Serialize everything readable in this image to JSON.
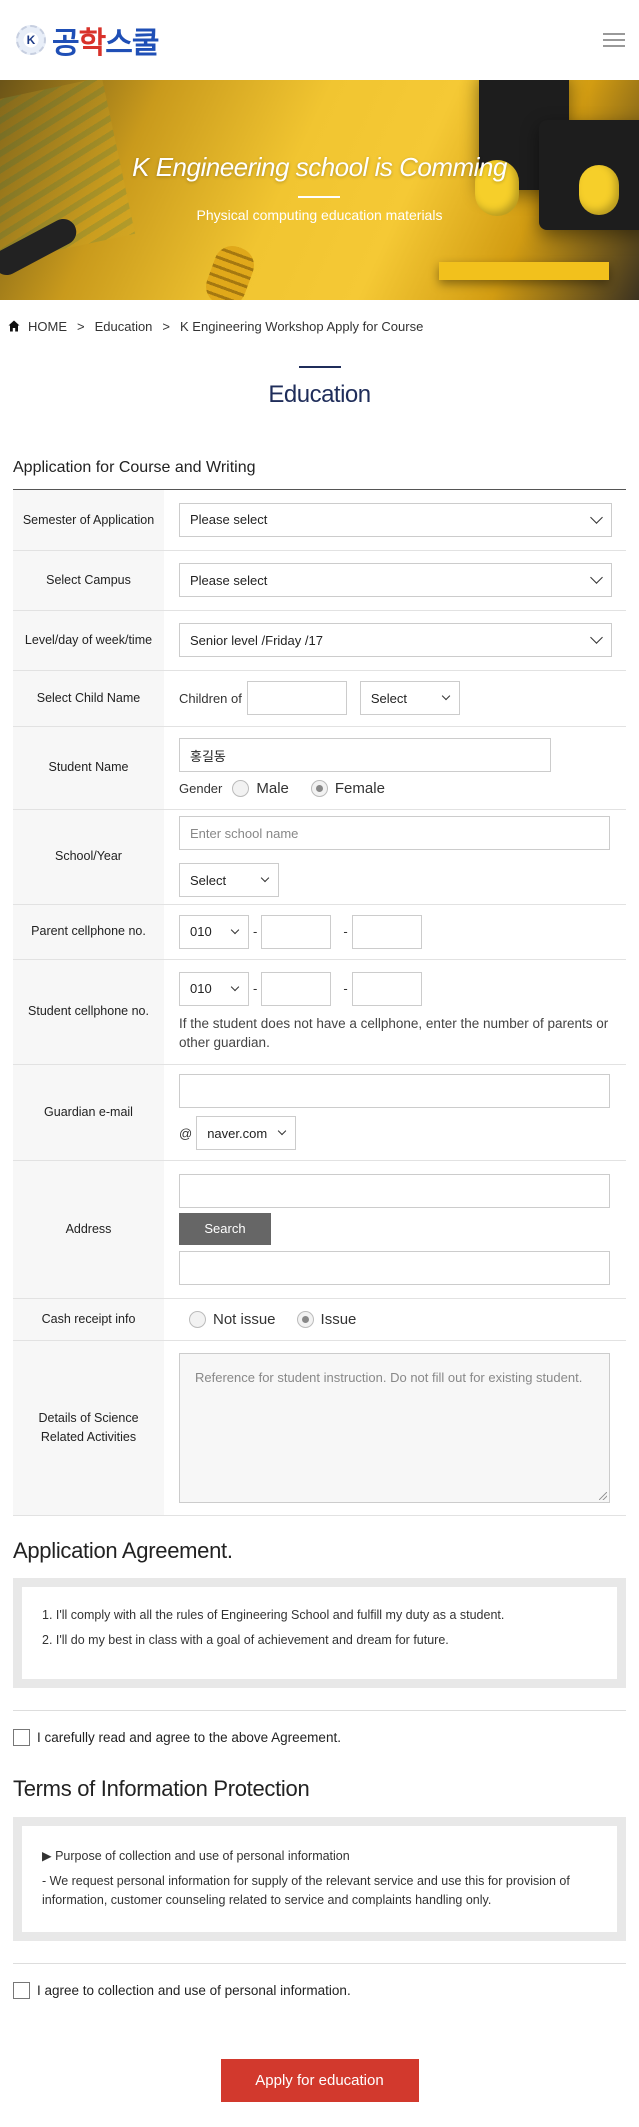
{
  "header": {
    "logo_badge": "K",
    "logo_text_1": "공",
    "logo_text_2": "학",
    "logo_text_3": "스쿨"
  },
  "hero": {
    "title": "K Engineering school is Comming",
    "subtitle": "Physical computing education materials"
  },
  "breadcrumb": {
    "home": "HOME",
    "sep": ">",
    "level1": "Education",
    "level2": "K Engineering Workshop Apply for Course"
  },
  "page": {
    "title": "Education",
    "form_title": "Application for Course and Writing"
  },
  "form": {
    "semester": {
      "label": "Semester of Application",
      "value": "Please select"
    },
    "campus": {
      "label": "Select Campus",
      "value": "Please select"
    },
    "level": {
      "label": "Level/day of week/time",
      "value": "Senior level /Friday /17"
    },
    "child": {
      "label": "Select Child Name",
      "prefix": "Children of",
      "select": "Select"
    },
    "student": {
      "label": "Student Name",
      "value": "홍길동",
      "gender_label": "Gender",
      "male": "Male",
      "female": "Female"
    },
    "school": {
      "label": "School/Year",
      "placeholder": "Enter school name",
      "select": "Select"
    },
    "parent_phone": {
      "label": "Parent cellphone no.",
      "prefix": "010",
      "dash": "-"
    },
    "student_phone": {
      "label": "Student cellphone no.",
      "prefix": "010",
      "dash": "-",
      "note": "If the student does not have a cellphone, enter the number of parents or other guardian."
    },
    "email": {
      "label": "Guardian e-mail",
      "at": "@",
      "domain": "naver.com"
    },
    "address": {
      "label": "Address",
      "search": "Search"
    },
    "cash_receipt": {
      "label": "Cash receipt info",
      "not_issue": "Not issue",
      "issue": "Issue"
    },
    "science": {
      "label_1": "Details of Science",
      "label_2": "Related Activities",
      "placeholder": "Reference for student instruction. Do not fill out for existing student."
    }
  },
  "agreement": {
    "title": "Application Agreement.",
    "item1": "1. I'll comply with all the rules of Engineering School and fulfill my duty as a student.",
    "item2": "2. I'll do my best in class with a goal of achievement and dream for future.",
    "check": "I carefully read and agree to the above Agreement."
  },
  "privacy": {
    "title": "Terms of Information Protection",
    "heading": "▶ Purpose of collection and use of personal information",
    "body": "- We request personal information for supply of the relevant service and use this for provision of information, customer counseling related to service and complaints handling only.",
    "check": "I agree to collection and use of personal information."
  },
  "submit": "Apply for education",
  "colors": {
    "navy": "#1f2d5a",
    "submit_red": "#d2392d",
    "label_bg": "#f7f7f7"
  }
}
